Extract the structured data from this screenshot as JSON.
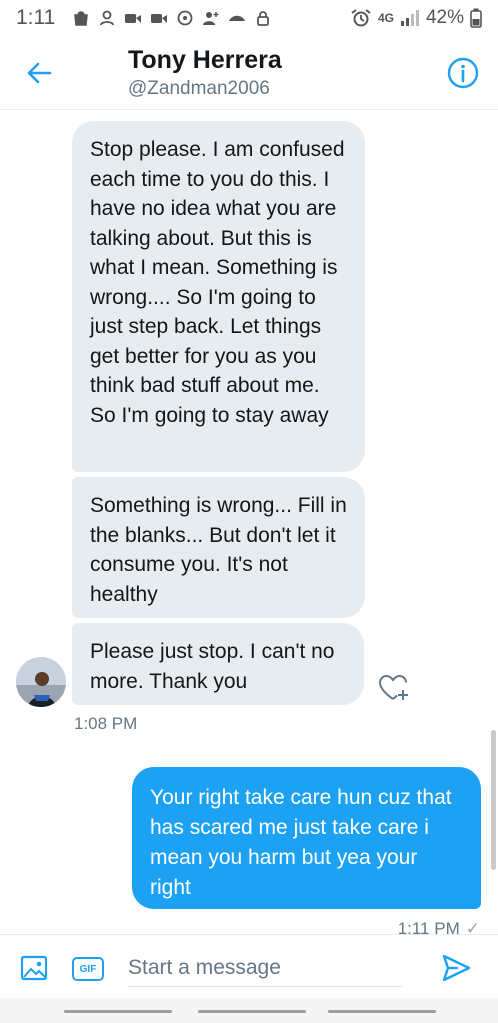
{
  "status_bar": {
    "time": "1:11",
    "network": "4G",
    "battery": "42%"
  },
  "header": {
    "name": "Tony Herrera",
    "handle": "@Zandman2006"
  },
  "messages": {
    "received": [
      "Stop please. I am confused each time to you do this. I have no idea what you are talking about. But this is what I mean. Something is wrong.... So I'm going to just step back. Let things get better for you as you think bad stuff about me. So I'm going to stay away",
      "Something is wrong... Fill in the blanks... But don't let it consume you. It's not healthy",
      "Please just stop. I can't no more. Thank you"
    ],
    "received_time": "1:08 PM",
    "sent": "Your right take care hun cuz that has scared me just take care i mean you harm but yea your right",
    "sent_time": "1:11 PM",
    "sent_status": "✓"
  },
  "composer": {
    "gif_label": "GIF",
    "placeholder": "Start a message"
  },
  "colors": {
    "accent": "#1da1f2",
    "bubble_in": "#e6ecf0",
    "muted": "#657786"
  }
}
